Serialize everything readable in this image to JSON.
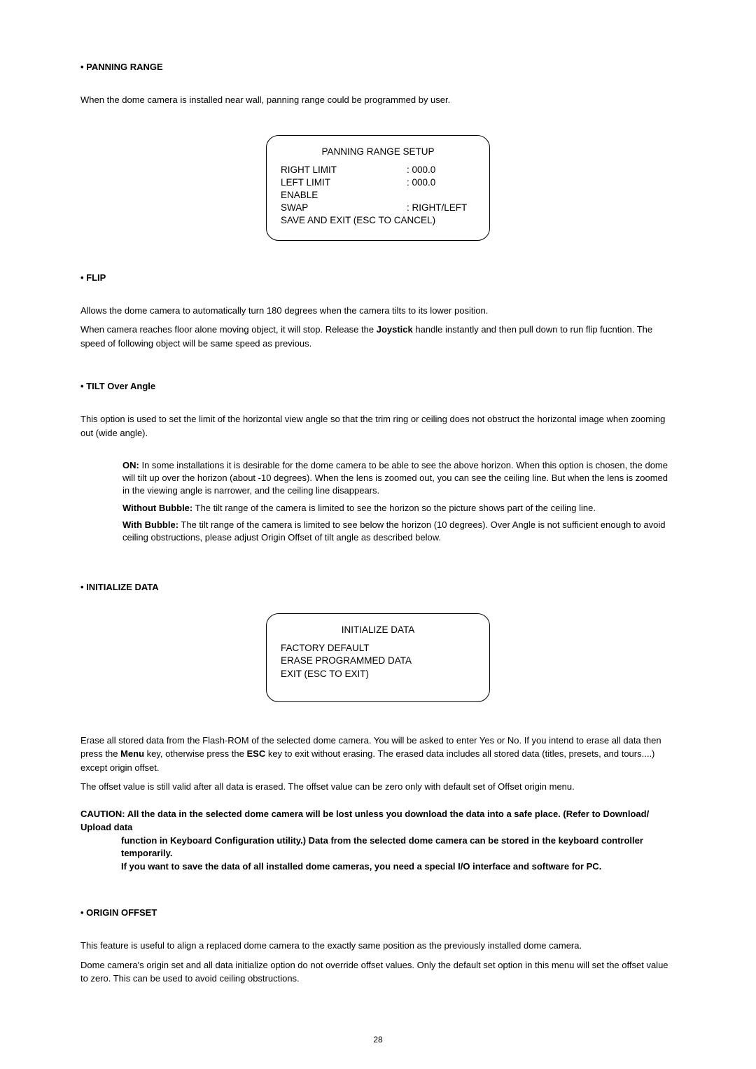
{
  "sections": {
    "panning": {
      "title": "•  PANNING RANGE",
      "p1": "When the dome camera is installed near wall, panning range could be programmed by user."
    },
    "flip": {
      "title": "•  FLIP",
      "p1": "Allows the dome camera to automatically turn 180 degrees when the camera tilts to its lower position.",
      "p2a": "When camera reaches floor alone moving object, it will stop. Release the ",
      "p2bold": "Joystick",
      "p2b": " handle instantly and then pull down to run flip fucntion. The speed of following object will be same speed as previous."
    },
    "tilt": {
      "title": "•  TILT Over Angle",
      "p1": "This option is used to set the limit of the horizontal view angle so that the trim ring or ceiling does not obstruct the horizontal image when zooming out (wide angle).",
      "on_label": "ON:",
      "on_text": " In some installations it is desirable for the dome camera to be able to see the above horizon. When this option is chosen, the dome will tilt up over the horizon (about -10 degrees). When the lens is zoomed out, you can see the ceiling line. But when the lens is zoomed in the viewing angle is narrower, and the ceiling line disappears.",
      "wo_label": "Without Bubble:",
      "wo_text": " The tilt range of the camera is limited to see the horizon so the picture shows part of the ceiling line.",
      "wb_label": "With Bubble:",
      "wb_text": " The tilt range of the camera is limited to see below the horizon (10 degrees). Over Angle is not sufficient enough to avoid ceiling obstructions, please adjust Origin Offset of tilt angle as described below."
    },
    "init": {
      "title": "•  INITIALIZE DATA",
      "p1a": "Erase all stored data from the Flash-ROM of the selected dome camera. You will be asked to enter Yes or No. If you intend to erase all data then press the ",
      "menu_bold": "Menu",
      "p1b": " key, otherwise press the ",
      "esc_bold": "ESC",
      "p1c": " key to exit without erasing. The erased data includes all stored data (titles, presets, and tours....) except origin offset.",
      "p2": "The offset value is still valid after all data is erased. The offset value can be zero only with default set of Offset origin menu.",
      "caution_lead": "CAUTION: ",
      "caution_l1": "All the data in the selected dome camera will be lost unless you download the data into a safe place. (Refer to Download/ Upload data",
      "caution_l2": "function in Keyboard Configuration utility.) Data from the selected dome camera can be stored in the keyboard controller temporarily.",
      "caution_l3": "If you want to save the data of all installed dome cameras, you need a special I/O interface and software for PC."
    },
    "origin": {
      "title": "•  ORIGIN OFFSET",
      "p1": "This feature is useful to align a replaced dome camera to the exactly same position as the previously installed dome camera.",
      "p2": "Dome camera's origin set and all data initialize option do not override offset values. Only the default set option in this menu will set the offset value to zero. This can be used to avoid ceiling obstructions."
    }
  },
  "menu1": {
    "title": "PANNING RANGE SETUP",
    "r1l": "RIGHT LIMIT",
    "r1v": ": 000.0",
    "r2l": "LEFT LIMIT",
    "r2v": ": 000.0",
    "r3l": "ENABLE",
    "r4l": "SWAP",
    "r4v": ": RIGHT/LEFT",
    "r5l": "SAVE AND EXIT (ESC TO  CANCEL)"
  },
  "menu2": {
    "title": "INITIALIZE DATA",
    "r1": "FACTORY DEFAULT",
    "r2": "ERASE PROGRAMMED DATA",
    "r3": "EXIT (ESC TO EXIT)"
  },
  "page": "28"
}
